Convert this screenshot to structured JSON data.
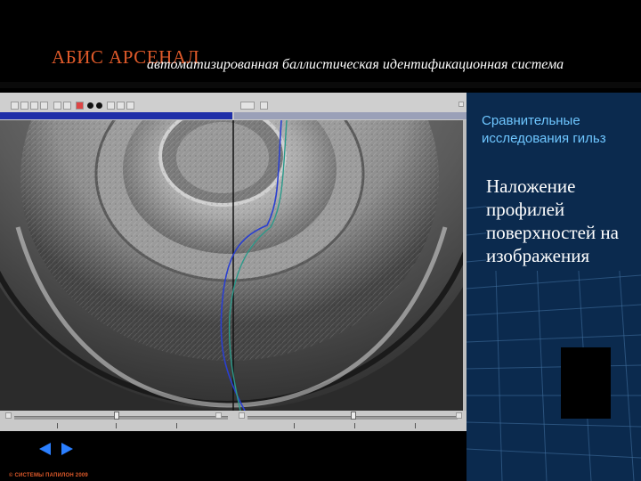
{
  "header": {
    "brand": "АБИС АРСЕНАЛ",
    "subtitle": "автоматизированная баллистическая идентификационная система"
  },
  "panel": {
    "title": "Сравнительные исследования гильз",
    "body": "Наложение профилей поверхностей на изображения"
  },
  "app": {
    "toolbar_icons": [
      "open-icon",
      "save-icon",
      "print-icon",
      "grid-icon",
      "zoom-icon",
      "scissors-icon",
      "color-icon",
      "black-dot-icon",
      "black-dot-icon",
      "split-icon",
      "frame-icon",
      "settings-icon"
    ],
    "profile_colors": {
      "left": "#2a3fd0",
      "right": "#2a9a8a"
    }
  },
  "nav": {
    "prev_icon": "arrow-left-icon",
    "next_icon": "arrow-right-icon"
  },
  "footer": {
    "copyright": "© СИСТЕМЫ ПАПИЛОН 2009"
  },
  "colors": {
    "brand": "#e05a2a",
    "panel_bg": "#0b2a4e",
    "panel_title": "#6ec6ff",
    "nav": "#2b7fff"
  }
}
